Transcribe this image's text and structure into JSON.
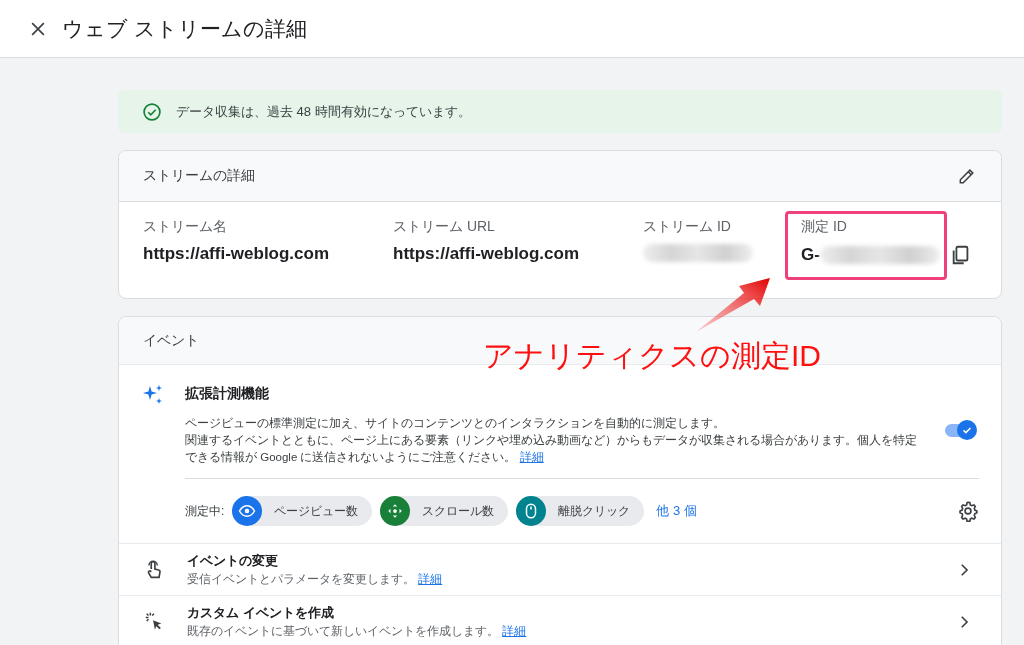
{
  "header": {
    "title": "ウェブ ストリームの詳細"
  },
  "banner": {
    "text": "データ収集は、過去 48 時間有効になっています。"
  },
  "stream_card": {
    "title": "ストリームの詳細",
    "fields": [
      {
        "label": "ストリーム名",
        "value": "https://affi-weblog.com",
        "kind": "text"
      },
      {
        "label": "ストリーム URL",
        "value": "https://affi-weblog.com",
        "kind": "text"
      },
      {
        "label": "ストリーム ID",
        "kind": "blurred"
      },
      {
        "label": "測定 ID",
        "value": "G-",
        "kind": "blurred_id"
      }
    ]
  },
  "events_card": {
    "title": "イベント",
    "enhanced": {
      "title": "拡張計測機能",
      "description": [
        "ページビューの標準測定に加え、サイトのコンテンツとのインタラクションを自動的に測定します。",
        "関連するイベントとともに、ページ上にある要素（リンクや埋め込み動画など）からもデータが収集される場合があります。個人を特定できる情報が Google に送信されないようにご注意ください。"
      ],
      "link": "詳細",
      "on": true,
      "measuring_label": "測定中:",
      "chips": [
        {
          "label": "ページビュー数",
          "kind": "eye",
          "color": "#1a73e8"
        },
        {
          "label": "スクロール数",
          "kind": "scroll",
          "color": "#188038"
        },
        {
          "label": "離脱クリック",
          "kind": "mouse",
          "color": "#00838f"
        }
      ],
      "more": "他 3 個"
    },
    "rows": [
      {
        "title": "イベントの変更",
        "description": "受信イベントとパラメータを変更します。",
        "link": "詳細",
        "kind": "touch"
      },
      {
        "title": "カスタム イベントを作成",
        "description": "既存のイベントに基づいて新しいイベントを作成します。",
        "link": "詳細",
        "kind": "click"
      }
    ]
  },
  "annotation": {
    "text": "アナリティクスの測定ID"
  }
}
